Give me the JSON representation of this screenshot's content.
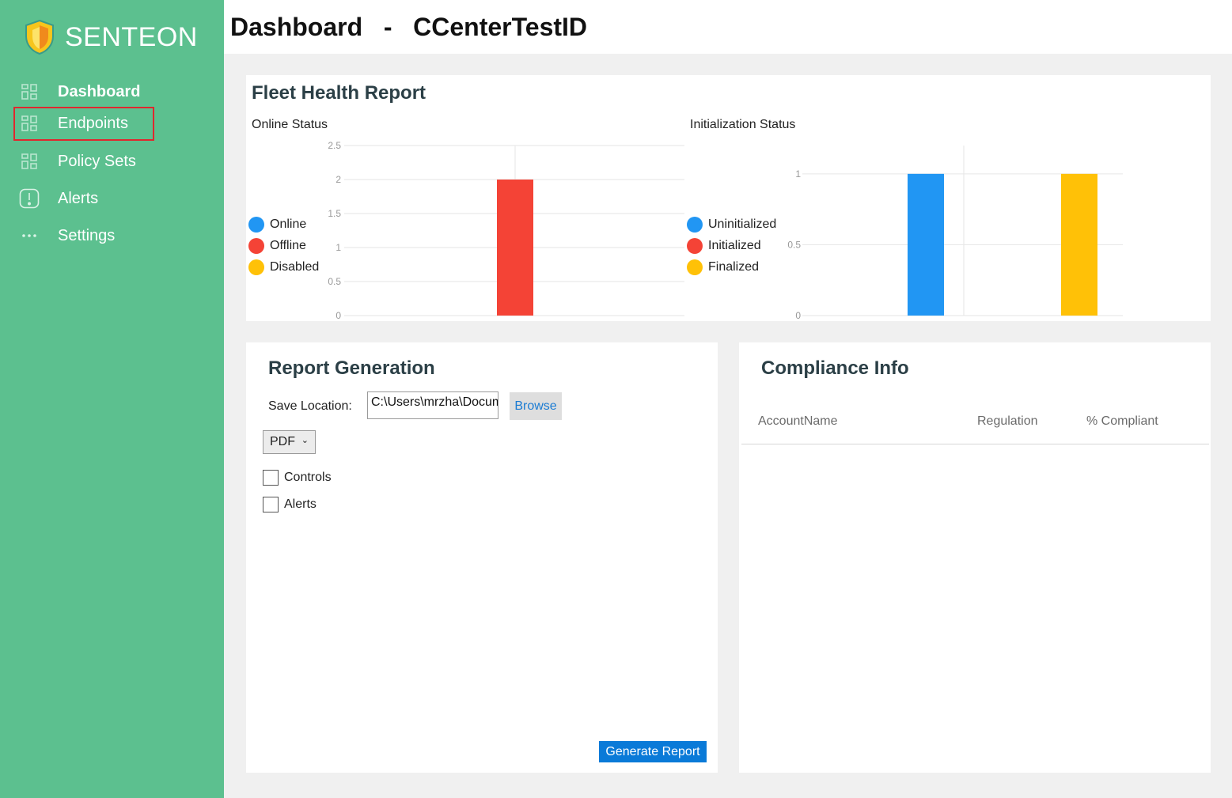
{
  "app": {
    "brand": "SENTEON"
  },
  "header": {
    "title": "Dashboard   -   CCenterTestID"
  },
  "sidebar": {
    "items": [
      {
        "label": "Dashboard",
        "icon": "grid-icon"
      },
      {
        "label": "Endpoints",
        "icon": "grid-icon"
      },
      {
        "label": "Policy Sets",
        "icon": "grid-icon"
      },
      {
        "label": "Alerts",
        "icon": "alert-icon"
      },
      {
        "label": "Settings",
        "icon": "more-icon"
      }
    ]
  },
  "fleet": {
    "title": "Fleet Health Report",
    "online_title": "Online Status",
    "init_title": "Initialization Status"
  },
  "chart_data": [
    {
      "type": "bar",
      "title": "Online Status",
      "series": [
        {
          "name": "Online",
          "color": "#2196f3",
          "value": 0
        },
        {
          "name": "Offline",
          "color": "#f44336",
          "value": 2
        },
        {
          "name": "Disabled",
          "color": "#ffc107",
          "value": 0
        }
      ],
      "ylim": [
        0,
        2.5
      ],
      "yticks": [
        "0",
        "0.5",
        "1",
        "1.5",
        "2",
        "2.5"
      ],
      "grid": true,
      "legend": "left"
    },
    {
      "type": "bar",
      "title": "Initialization Status",
      "series": [
        {
          "name": "Uninitialized",
          "color": "#2196f3",
          "value": 1
        },
        {
          "name": "Initialized",
          "color": "#f44336",
          "value": 0
        },
        {
          "name": "Finalized",
          "color": "#ffc107",
          "value": 1
        }
      ],
      "ylim": [
        0,
        1.2
      ],
      "yticks": [
        "0",
        "0.5",
        "1"
      ],
      "grid": true,
      "legend": "left"
    }
  ],
  "report": {
    "title": "Report Generation",
    "save_label": "Save Location:",
    "save_path": "C:\\Users\\mrzha\\Documents",
    "browse_label": "Browse",
    "format": "PDF",
    "checkboxes": [
      {
        "label": "Controls",
        "checked": false
      },
      {
        "label": "Alerts",
        "checked": false
      }
    ],
    "generate_label": "Generate Report"
  },
  "compliance": {
    "title": "Compliance Info",
    "columns": [
      "AccountName",
      "Regulation",
      "% Compliant"
    ]
  }
}
